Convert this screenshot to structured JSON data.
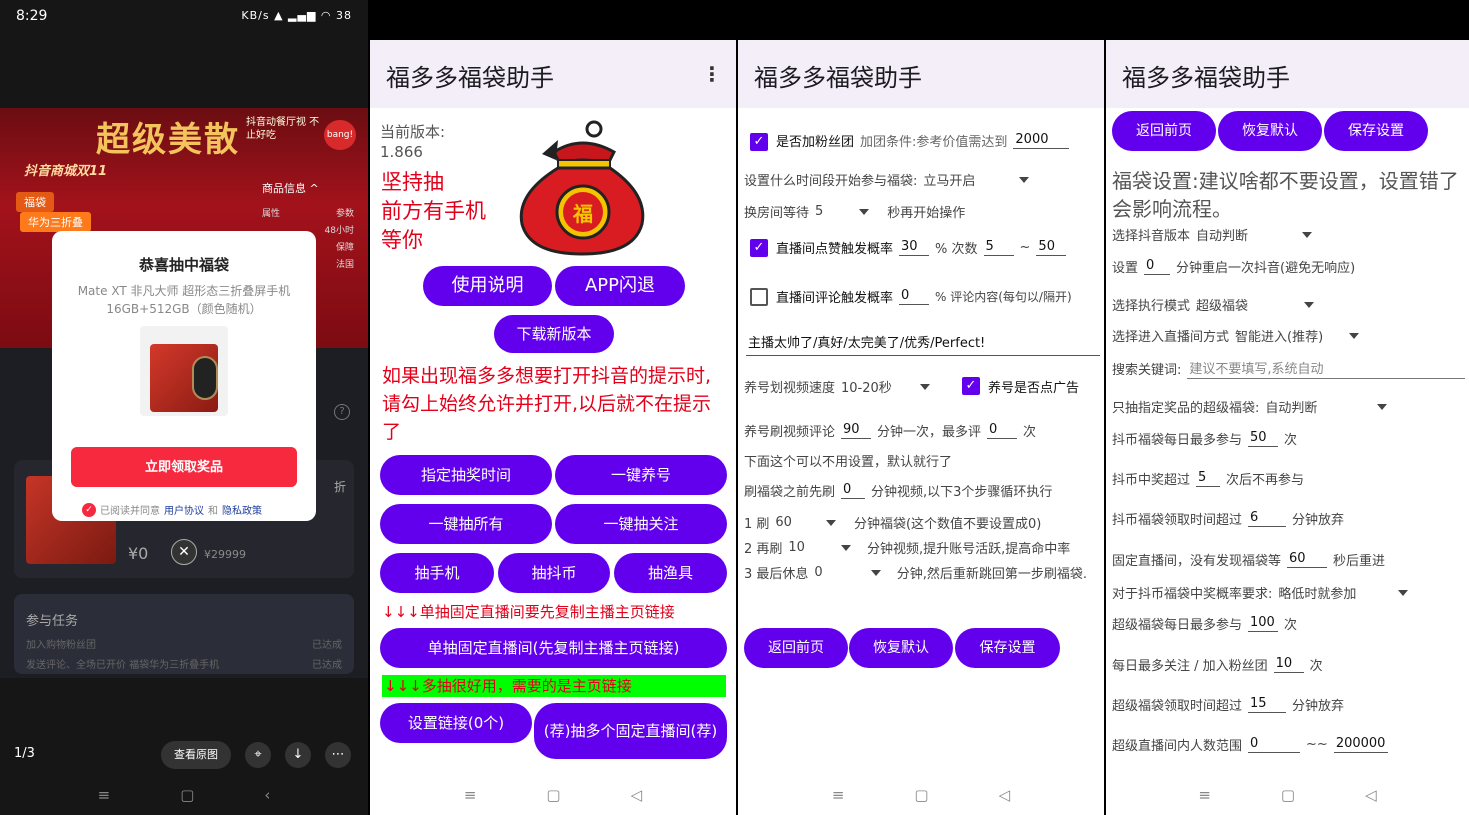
{
  "screen1": {
    "time": "8:29",
    "status_right": "KB/s ▲ ▂▄▆ ◠ 38",
    "banner_title": "超级美散",
    "banner_note": "抖音动餐厅视 不止好吃",
    "bang": "bang!",
    "mall": "抖音商城双11",
    "tag1": "福袋",
    "tag2": "华为三折叠",
    "info_title": "商品信息 ^",
    "info_rows": [
      [
        "属性",
        "参数"
      ],
      [
        "",
        "48小时"
      ],
      [
        "",
        "保障"
      ],
      [
        "",
        "法国"
      ]
    ],
    "popup_title": "恭喜抽中福袋",
    "popup_desc": "Mate XT 非凡大师 超形态三折叠屏手机 16GB+512GB（颜色随机）",
    "popup_btn": "立即领取奖品",
    "agree_text": "已阅读并同意",
    "agree_link1": "用户协议",
    "agree_and": "和",
    "agree_link2": "隐私政策",
    "help": "?",
    "zhe": "折",
    "price": "¥0",
    "orig_price": "¥29999",
    "tasks_title": "参与任务",
    "task_rows": [
      [
        "加入购物粉丝团",
        "已达成"
      ],
      [
        "发送评论、全场已开价 福袋华为三折叠手机",
        "已达成"
      ]
    ],
    "page": "1/3",
    "view_orig": "查看原图"
  },
  "screen2": {
    "title": "福多多福袋助手",
    "version_label": "当前版本:",
    "version": "1.866",
    "slogan1": "坚持抽",
    "slogan2": "前方有手机",
    "slogan3": "等你",
    "bag_char": "福",
    "btn_manual": "使用说明",
    "btn_crash": "APP闪退",
    "btn_download": "下载新版本",
    "notice": "如果出现福多多想要打开抖音的提示时,请勾上始终允许并打开,以后就不在提示了",
    "btn_time": "指定抽奖时间",
    "btn_raise": "一键养号",
    "btn_all": "一键抽所有",
    "btn_follow": "一键抽关注",
    "btn_phone": "抽手机",
    "btn_coin": "抽抖币",
    "btn_fish": "抽渔具",
    "hint1": "↓↓↓单抽固定直播间要先复制主播主页链接",
    "btn_single": "单抽固定直播间(先复制主播主页链接)",
    "hint2": "↓↓↓多抽很好用，需要的是主页链接",
    "btn_links": "设置链接(0个)",
    "btn_multi": "(荐)抽多个固定直播间(荐)"
  },
  "screen3": {
    "title": "福多多福袋助手",
    "fans_label": "是否加粉丝团",
    "fans_cond": "加团条件:参考价值需达到",
    "fans_value": "2000",
    "start_label": "设置什么时间段开始参与福袋:",
    "start_value": "立马开启",
    "room_wait_label": "换房间等待",
    "room_wait_value": "5",
    "room_wait_suffix": "秒再开始操作",
    "like_label": "直播间点赞触发概率",
    "like_prob": "30",
    "like_mid": "% 次数",
    "like_min": "5",
    "like_tilde": "~",
    "like_max": "50",
    "comment_label": "直播间评论触发概率",
    "comment_prob": "0",
    "comment_suffix": "% 评论内容(每句以/隔开)",
    "comment_text": "主播太帅了/真好/太完美了/优秀/Perfect!",
    "speed_label": "养号划视频速度",
    "speed_value": "10-20秒",
    "ad_label": "养号是否点广告",
    "video_comment_label": "养号刷视频评论",
    "video_comment_value": "90",
    "video_comment_mid": "分钟一次，最多评",
    "video_comment_max": "0",
    "video_comment_suffix": "次",
    "default_note": "下面这个可以不用设置，默认就行了",
    "pre_label": "刷福袋之前先刷",
    "pre_value": "0",
    "pre_suffix": "分钟视频,以下3个步骤循环执行",
    "step1_label": "1 刷",
    "step1_value": "60",
    "step1_suffix": "分钟福袋(这个数值不要设置成0)",
    "step2_label": "2 再刷",
    "step2_value": "10",
    "step2_suffix": "分钟视频,提升账号活跃,提高命中率",
    "step3_label": "3 最后休息",
    "step3_value": "0",
    "step3_suffix": "分钟,然后重新跳回第一步刷福袋.",
    "btn_back": "返回前页",
    "btn_reset": "恢复默认",
    "btn_save": "保存设置"
  },
  "screen4": {
    "title": "福多多福袋助手",
    "btn_back": "返回前页",
    "btn_reset": "恢复默认",
    "btn_save": "保存设置",
    "warn": "福袋设置:建议啥都不要设置，设置错了会影响流程。",
    "version_label": "选择抖音版本",
    "version_value": "自动判断",
    "restart_label": "设置",
    "restart_value": "0",
    "restart_suffix": "分钟重启一次抖音(避免无响应)",
    "mode_label": "选择执行模式",
    "mode_value": "超级福袋",
    "enter_label": "选择进入直播间方式",
    "enter_value": "智能进入(推荐)",
    "keyword_label": "搜索关键词:",
    "keyword_placeholder": "建议不要填写,系统自动",
    "prize_label": "只抽指定奖品的超级福袋:",
    "prize_value": "自动判断",
    "coin_daily_label": "抖币福袋每日最多参与",
    "coin_daily_value": "50",
    "coin_daily_suffix": "次",
    "coin_win_label": "抖币中奖超过",
    "coin_win_value": "5",
    "coin_win_suffix": "次后不再参与",
    "coin_time_label": "抖币福袋领取时间超过",
    "coin_time_value": "6",
    "coin_time_suffix": "分钟放弃",
    "fixed_label": "固定直播间，没有发现福袋等",
    "fixed_value": "60",
    "fixed_suffix": "秒后重进",
    "coin_prob_label": "对于抖币福袋中奖概率要求:",
    "coin_prob_value": "略低时就参加",
    "super_daily_label": "超级福袋每日最多参与",
    "super_daily_value": "100",
    "super_daily_suffix": "次",
    "follow_label": "每日最多关注 / 加入粉丝团",
    "follow_value": "10",
    "follow_suffix": "次",
    "super_time_label": "超级福袋领取时间超过",
    "super_time_value": "15",
    "super_time_suffix": "分钟放弃",
    "range_label": "超级直播间内人数范围",
    "range_min": "0",
    "range_tilde": "~~",
    "range_max": "200000"
  },
  "colors": {
    "primary": "#6200ee",
    "red": "#e3001b",
    "appbar": "#f4eef9",
    "hint_green": "#00ff00"
  }
}
